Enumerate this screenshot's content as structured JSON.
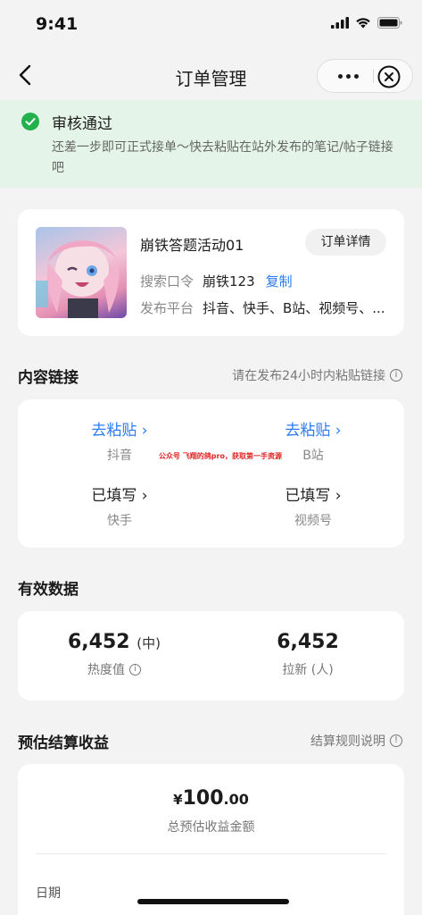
{
  "status_bar": {
    "time": "9:41"
  },
  "nav": {
    "title": "订单管理"
  },
  "banner": {
    "title": "审核通过",
    "desc": "还差一步即可正式接单～快去粘贴在站外发布的笔记/帖子链接吧",
    "color": "#22b14c"
  },
  "order": {
    "name": "崩铁答题活动01",
    "detail_btn": "订单详情",
    "search_label": "搜索口令",
    "search_value": "崩铁123",
    "copy_label": "复制",
    "platform_label": "发布平台",
    "platform_value": "抖音、快手、B站、视频号、..."
  },
  "content_links": {
    "title": "内容链接",
    "hint": "请在发布24小时内粘贴链接",
    "watermark": "公众号 飞翔的鸽pro，获取第一手资源",
    "items": [
      {
        "action": "去粘贴 ›",
        "platform": "抖音"
      },
      {
        "action": "去粘贴 ›",
        "platform": "B站"
      },
      {
        "action": "已填写 ›",
        "platform": "快手"
      },
      {
        "action": "已填写 ›",
        "platform": "视频号"
      }
    ]
  },
  "stats": {
    "title": "有效数据",
    "heat_value": "6,452",
    "heat_suffix": "(中)",
    "heat_label": "热度值",
    "new_value": "6,452",
    "new_label": "拉新 (人)"
  },
  "income": {
    "title": "预估结算收益",
    "hint": "结算规则说明",
    "currency": "¥",
    "amount_int": "100",
    "amount_dec": ".00",
    "amount_label": "总预估收益金额",
    "date_label": "日期"
  },
  "colors": {
    "accent": "#2b7cf2",
    "page_bg": "#f3f3f3",
    "banner_bg": "#e4f4e8"
  }
}
